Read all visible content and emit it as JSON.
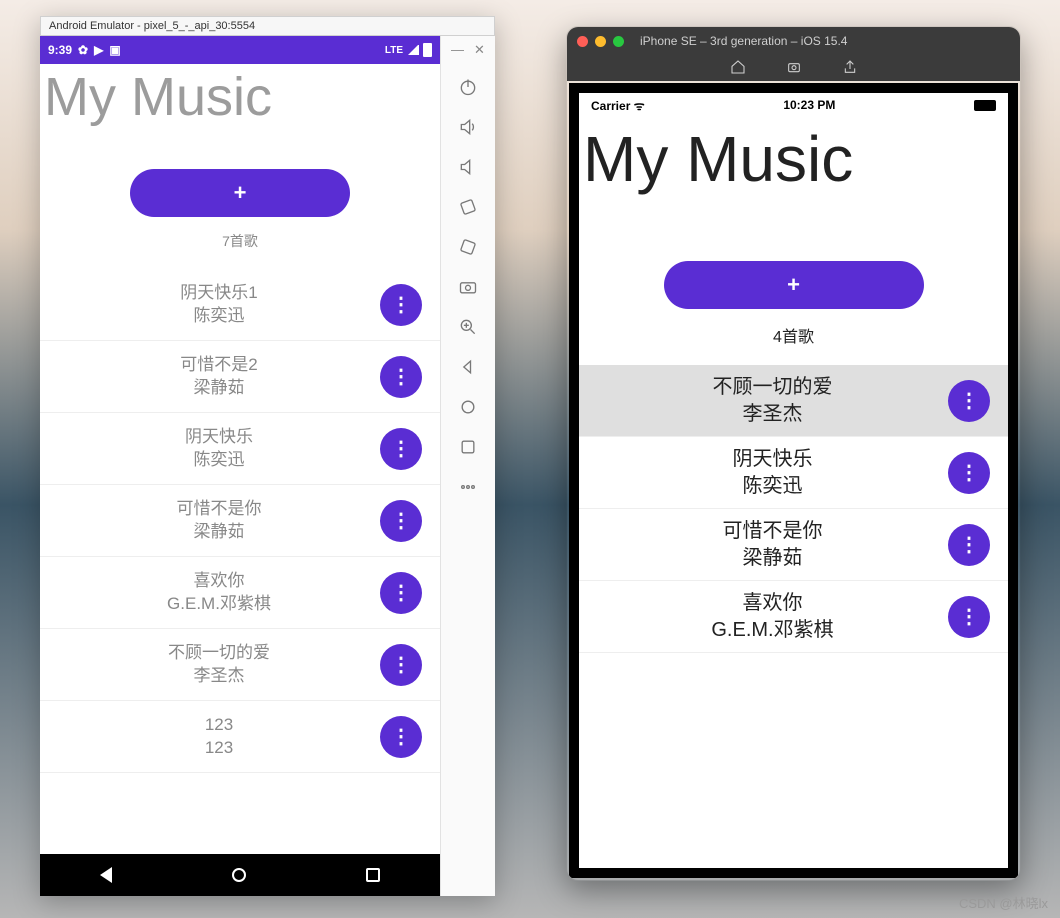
{
  "watermark": "CSDN @林晓lx",
  "android": {
    "window_title": "Android Emulator - pixel_5_-_api_30:5554",
    "status": {
      "time": "9:39",
      "net": "LTE"
    },
    "app_title": "My Music",
    "count_label": "7首歌",
    "add_label": "+",
    "songs": [
      {
        "title": "阴天快乐1",
        "artist": "陈奕迅"
      },
      {
        "title": "可惜不是2",
        "artist": "梁静茹"
      },
      {
        "title": "阴天快乐",
        "artist": "陈奕迅"
      },
      {
        "title": "可惜不是你",
        "artist": "梁静茹"
      },
      {
        "title": "喜欢你",
        "artist": "G.E.M.邓紫棋"
      },
      {
        "title": "不顾一切的爱",
        "artist": "李圣杰"
      },
      {
        "title": "123",
        "artist": "123"
      }
    ],
    "more_glyph": "⋮",
    "side_tools": [
      "power",
      "volume-up",
      "volume-down",
      "rotate-left",
      "rotate-right",
      "camera",
      "zoom-in",
      "back",
      "overview",
      "screenshot",
      "more"
    ],
    "window_controls": {
      "min": "—",
      "close": "✕"
    }
  },
  "ios": {
    "window_title": "iPhone SE – 3rd generation – iOS 15.4",
    "status": {
      "carrier": "Carrier",
      "time": "10:23 PM"
    },
    "app_title": "My Music",
    "count_label": "4首歌",
    "add_label": "+",
    "songs": [
      {
        "title": "不顾一切的爱",
        "artist": "李圣杰",
        "selected": true
      },
      {
        "title": "阴天快乐",
        "artist": "陈奕迅"
      },
      {
        "title": "可惜不是你",
        "artist": "梁静茹"
      },
      {
        "title": "喜欢你",
        "artist": "G.E.M.邓紫棋"
      }
    ],
    "more_glyph": "⋮",
    "toolbar_icons": [
      "home",
      "screenshot",
      "share"
    ]
  }
}
